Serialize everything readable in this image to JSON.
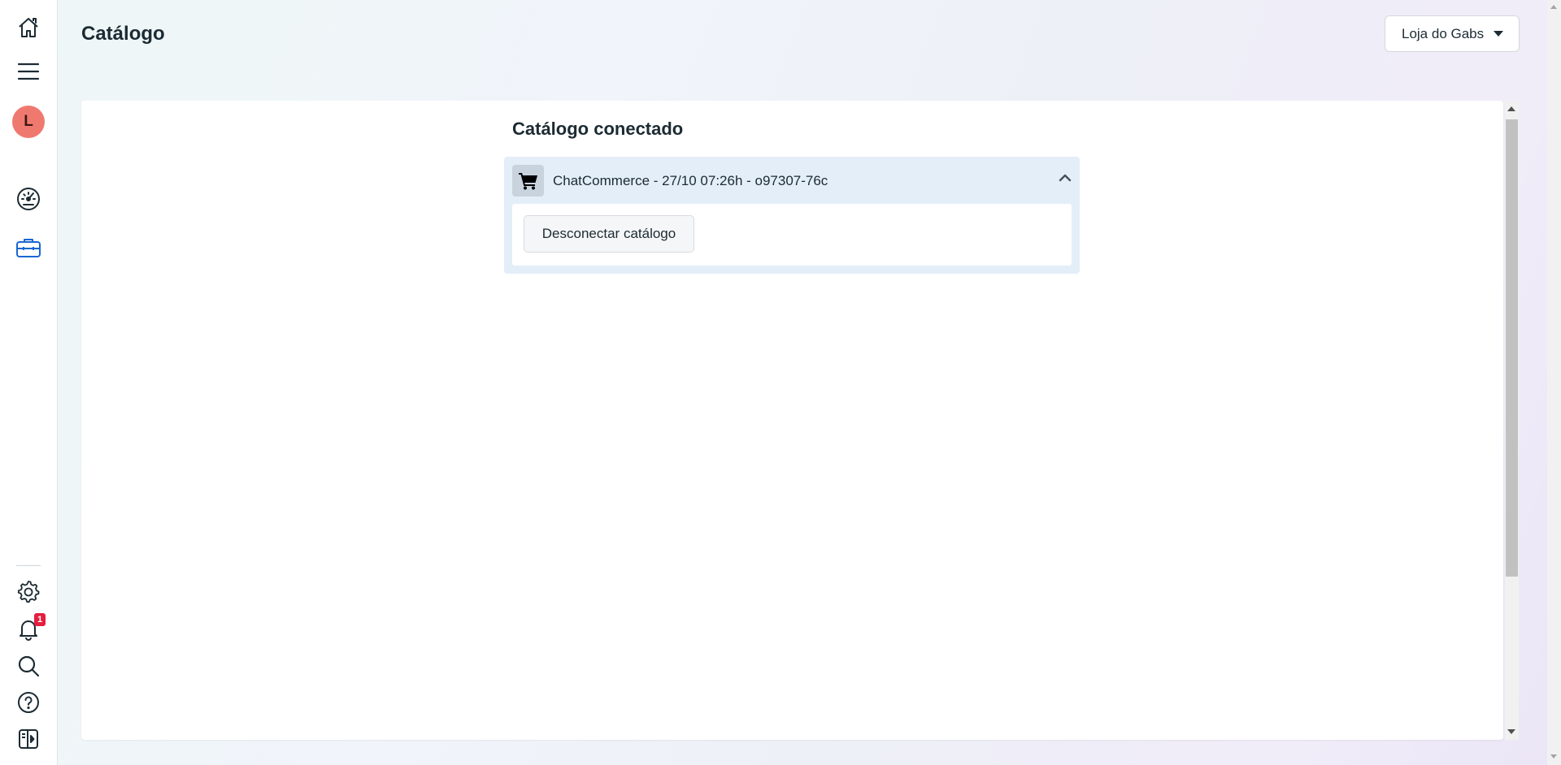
{
  "page": {
    "title": "Catálogo"
  },
  "store_selector": {
    "value": "Loja do Gabs"
  },
  "sidebar": {
    "avatar_initial": "L",
    "notification_count": "1",
    "icons": [
      "home-icon",
      "menu-icon",
      "dashboard-gauge-icon",
      "briefcase-icon",
      "gear-icon",
      "bell-icon",
      "search-icon",
      "help-icon",
      "collapse-panel-icon"
    ],
    "active_color": "#1a66d4"
  },
  "catalog": {
    "section_title": "Catálogo conectado",
    "item_label": "ChatCommerce - 27/10 07:26h - o97307-76c",
    "disconnect_label": "Desconectar catálogo"
  },
  "colors": {
    "accordion_bg": "#e4eef8",
    "avatar_bg": "#f0796f",
    "badge_bg": "#e41e3f"
  }
}
